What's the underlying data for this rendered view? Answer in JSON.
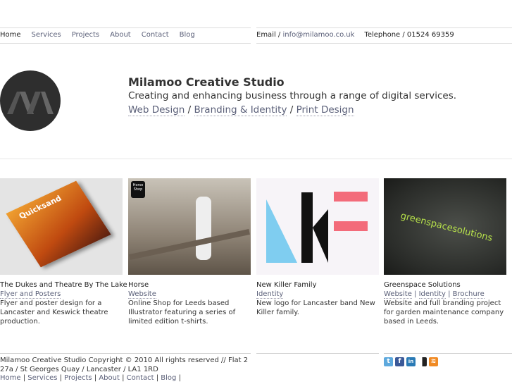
{
  "nav": {
    "items": [
      {
        "label": "Home"
      },
      {
        "label": "Services"
      },
      {
        "label": "Projects"
      },
      {
        "label": "About"
      },
      {
        "label": "Contact"
      },
      {
        "label": "Blog"
      }
    ]
  },
  "contact": {
    "email_label": "Email /",
    "email": "info@milamoo.co.uk",
    "phone": "Telephone / 01524 69359"
  },
  "hero": {
    "title": "Milamoo Creative Studio",
    "subtitle": "Creating and enhancing business through a range of digital services.",
    "services": [
      "Web Design",
      "Branding & Identity",
      "Print Design"
    ],
    "separator": "/"
  },
  "projects": [
    {
      "title": "The Dukes and Theatre By The Lake",
      "tags": [
        "Flyer and Posters"
      ],
      "desc": "Flyer and poster design for a Lancaster and Keswick theatre production.",
      "thumb_text": "Quicksand"
    },
    {
      "title": "Horse",
      "tags": [
        "Website"
      ],
      "desc": "Online Shop for Leeds based Illustrator featuring a series of limited edition t-shirts.",
      "thumb_text": "Horse Shop"
    },
    {
      "title": "New Killer Family",
      "tags": [
        "Identity"
      ],
      "desc": "New logo for Lancaster band New Killer family."
    },
    {
      "title": "Greenspace Solutions",
      "tags": [
        "Website",
        "Identity",
        "Brochure"
      ],
      "desc": "Website and full branding project for garden maintenance company based in Leeds.",
      "thumb_text": "greenspacesolutions"
    }
  ],
  "footer": {
    "copyright": "Milamoo Creative Studio Copyright © 2010 All rights reserved // Flat 2 27a / St Georges Quay / Lancaster / LA1 1RD",
    "links": [
      "Home",
      "Services",
      "Projects",
      "About",
      "Contact",
      "Blog"
    ]
  },
  "social": [
    {
      "icon": "twitter-icon",
      "glyph": "t",
      "color": "#5ea9dd"
    },
    {
      "icon": "facebook-icon",
      "glyph": "f",
      "color": "#3b5998"
    },
    {
      "icon": "linkedin-icon",
      "glyph": "in",
      "color": "#2a7ab5"
    },
    {
      "icon": "delicious-icon",
      "glyph": "",
      "color": "#3274d1"
    },
    {
      "icon": "rss-icon",
      "glyph": "≋",
      "color": "#f08a24"
    }
  ]
}
